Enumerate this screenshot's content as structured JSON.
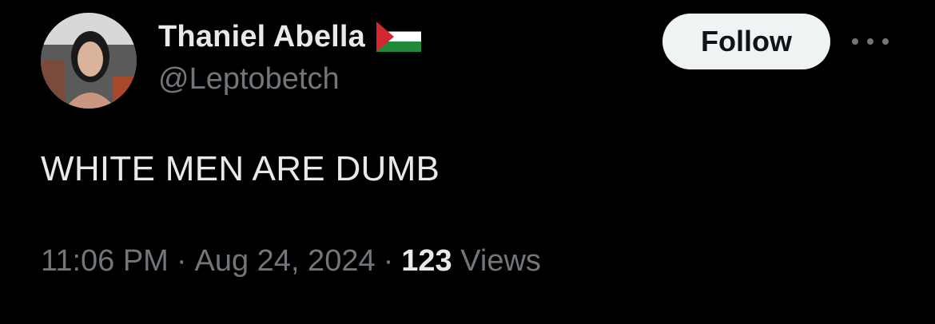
{
  "tweet": {
    "author": {
      "display_name": "Thaniel Abella",
      "handle": "@Leptobetch",
      "flag_icon": "palestine-flag-icon"
    },
    "follow_label": "Follow",
    "more_icon": "more-horizontal-icon",
    "text": "WHITE MEN ARE DUMB",
    "time": "11:06 PM",
    "separator": "·",
    "date": "Aug 24, 2024",
    "views_count": "123",
    "views_label": "Views"
  },
  "colors": {
    "background": "#000000",
    "primary_text": "#e7e9ea",
    "secondary_text": "#71767b",
    "follow_bg": "#eff3f4",
    "follow_text": "#0f1419"
  }
}
